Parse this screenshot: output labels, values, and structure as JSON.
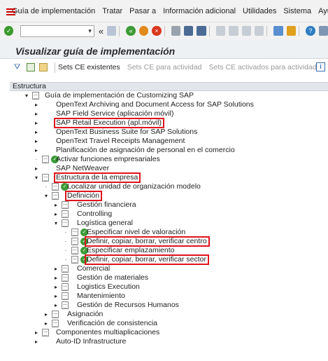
{
  "menu": [
    "Guía de implementación",
    "Tratar",
    "Pasar a",
    "Información adicional",
    "Utilidades",
    "Sistema",
    "Ayuda"
  ],
  "toolbar": {
    "command_value": "",
    "nav_symbol": "«",
    "collapse_symbol": "▾"
  },
  "title": "Visualizar guía de implementación",
  "app_toolbar": {
    "sets_ce": "Sets CE existentes",
    "sets_ce_actividad": "Sets CE para actividad",
    "sets_ce_activados": "Sets CE activados para actividad",
    "info_symbol": "i"
  },
  "tree": {
    "header": "Estructura",
    "nodes": [
      {
        "label": "Guía de implementación de Customizing SAP"
      },
      {
        "label": "OpenText Archiving and Document Access for SAP Solutions"
      },
      {
        "label": "SAP Field Service (aplicación móvil)"
      },
      {
        "label": "SAP Retail Execution (apl.móvil)"
      },
      {
        "label": "OpenText Business Suite for SAP Solutions"
      },
      {
        "label": "OpenText Travel Receipts Management"
      },
      {
        "label": "Planificación de asignación de personal en el comercio"
      },
      {
        "label": "Activar funciones empresariales"
      },
      {
        "label": "SAP NetWeaver"
      },
      {
        "label": "Estructura de la empresa"
      },
      {
        "label": "Localizar unidad de organización modelo"
      },
      {
        "label": "Definición"
      },
      {
        "label": "Gestión financiera"
      },
      {
        "label": "Controlling"
      },
      {
        "label": "Logística general"
      },
      {
        "label": "Especificar nivel de valoración"
      },
      {
        "label": "Definir, copiar, borrar, verificar centro"
      },
      {
        "label": "Especificar emplazamiento"
      },
      {
        "label": "Definir, copiar, borrar, verificar sector"
      },
      {
        "label": "Comercial"
      },
      {
        "label": "Gestión de materiales"
      },
      {
        "label": "Logistics Execution"
      },
      {
        "label": "Mantenimiento"
      },
      {
        "label": "Gestión de Recursos Humanos"
      },
      {
        "label": "Asignación"
      },
      {
        "label": "Verificación de consistencia"
      },
      {
        "label": "Componentes multiaplicaciones"
      },
      {
        "label": "Auto-ID Infrastructure"
      }
    ]
  },
  "colors": {
    "highlight": "#e0141e",
    "exec_green": "#3d9a36",
    "title_bg": "#eef1f4"
  }
}
